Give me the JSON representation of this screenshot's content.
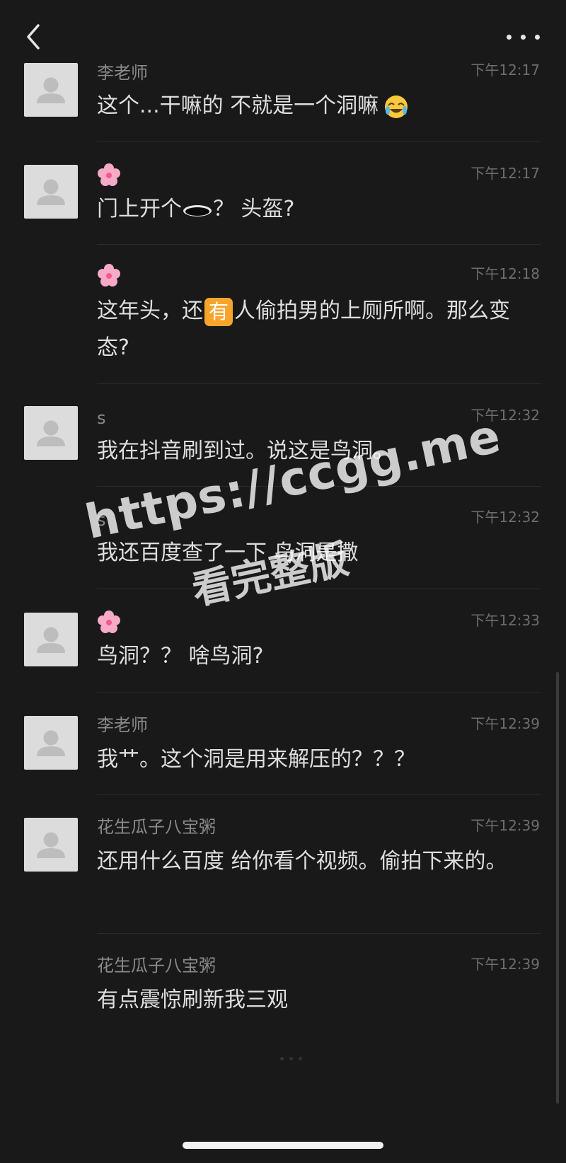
{
  "header": {
    "back_icon": "chevron-left-icon",
    "more_icon": "more-horizontal-icon"
  },
  "messages": [
    {
      "sender": "李老师",
      "time": "下午12:17",
      "text": "这个...干嘛的 不就是一个洞嘛",
      "emoji": "rolling-laughing-emoji",
      "avatar": true
    },
    {
      "sender": "🌸",
      "time": "下午12:17",
      "text_before": "门上开个",
      "text_after": "？ 头盔?",
      "emoji": "hole-icon",
      "avatar": true
    },
    {
      "sender": "🌸",
      "time": "下午12:18",
      "text_before": "这年头，还",
      "badge": "有",
      "text_after": "人偷拍男的上厕所啊。那么变态?",
      "avatar": false
    },
    {
      "sender": "s",
      "time": "下午12:32",
      "text": "我在抖音刷到过。说这是鸟洞。",
      "avatar": true
    },
    {
      "sender": "s",
      "time": "下午12:32",
      "text": "我还百度查了一下 鸟洞是撒",
      "avatar": false
    },
    {
      "sender": "🌸",
      "time": "下午12:33",
      "text": "鸟洞？？ 啥鸟洞?",
      "avatar": true
    },
    {
      "sender": "李老师",
      "time": "下午12:39",
      "text": "我艹。这个洞是用来解压的？？？",
      "avatar": true
    },
    {
      "sender": "花生瓜子八宝粥",
      "time": "下午12:39",
      "text": "还用什么百度 给你看个视频。偷拍下来的。",
      "avatar": true
    },
    {
      "sender": "花生瓜子八宝粥",
      "time": "下午12:39",
      "text": "有点震惊刷新我三观",
      "avatar": false
    }
  ],
  "watermark": {
    "url": "https://ccgg.me",
    "label": "看完整版"
  },
  "colors": {
    "background": "#191919",
    "sender": "#8a8a8a",
    "message": "#dedede",
    "badge": "#f7a52a"
  }
}
